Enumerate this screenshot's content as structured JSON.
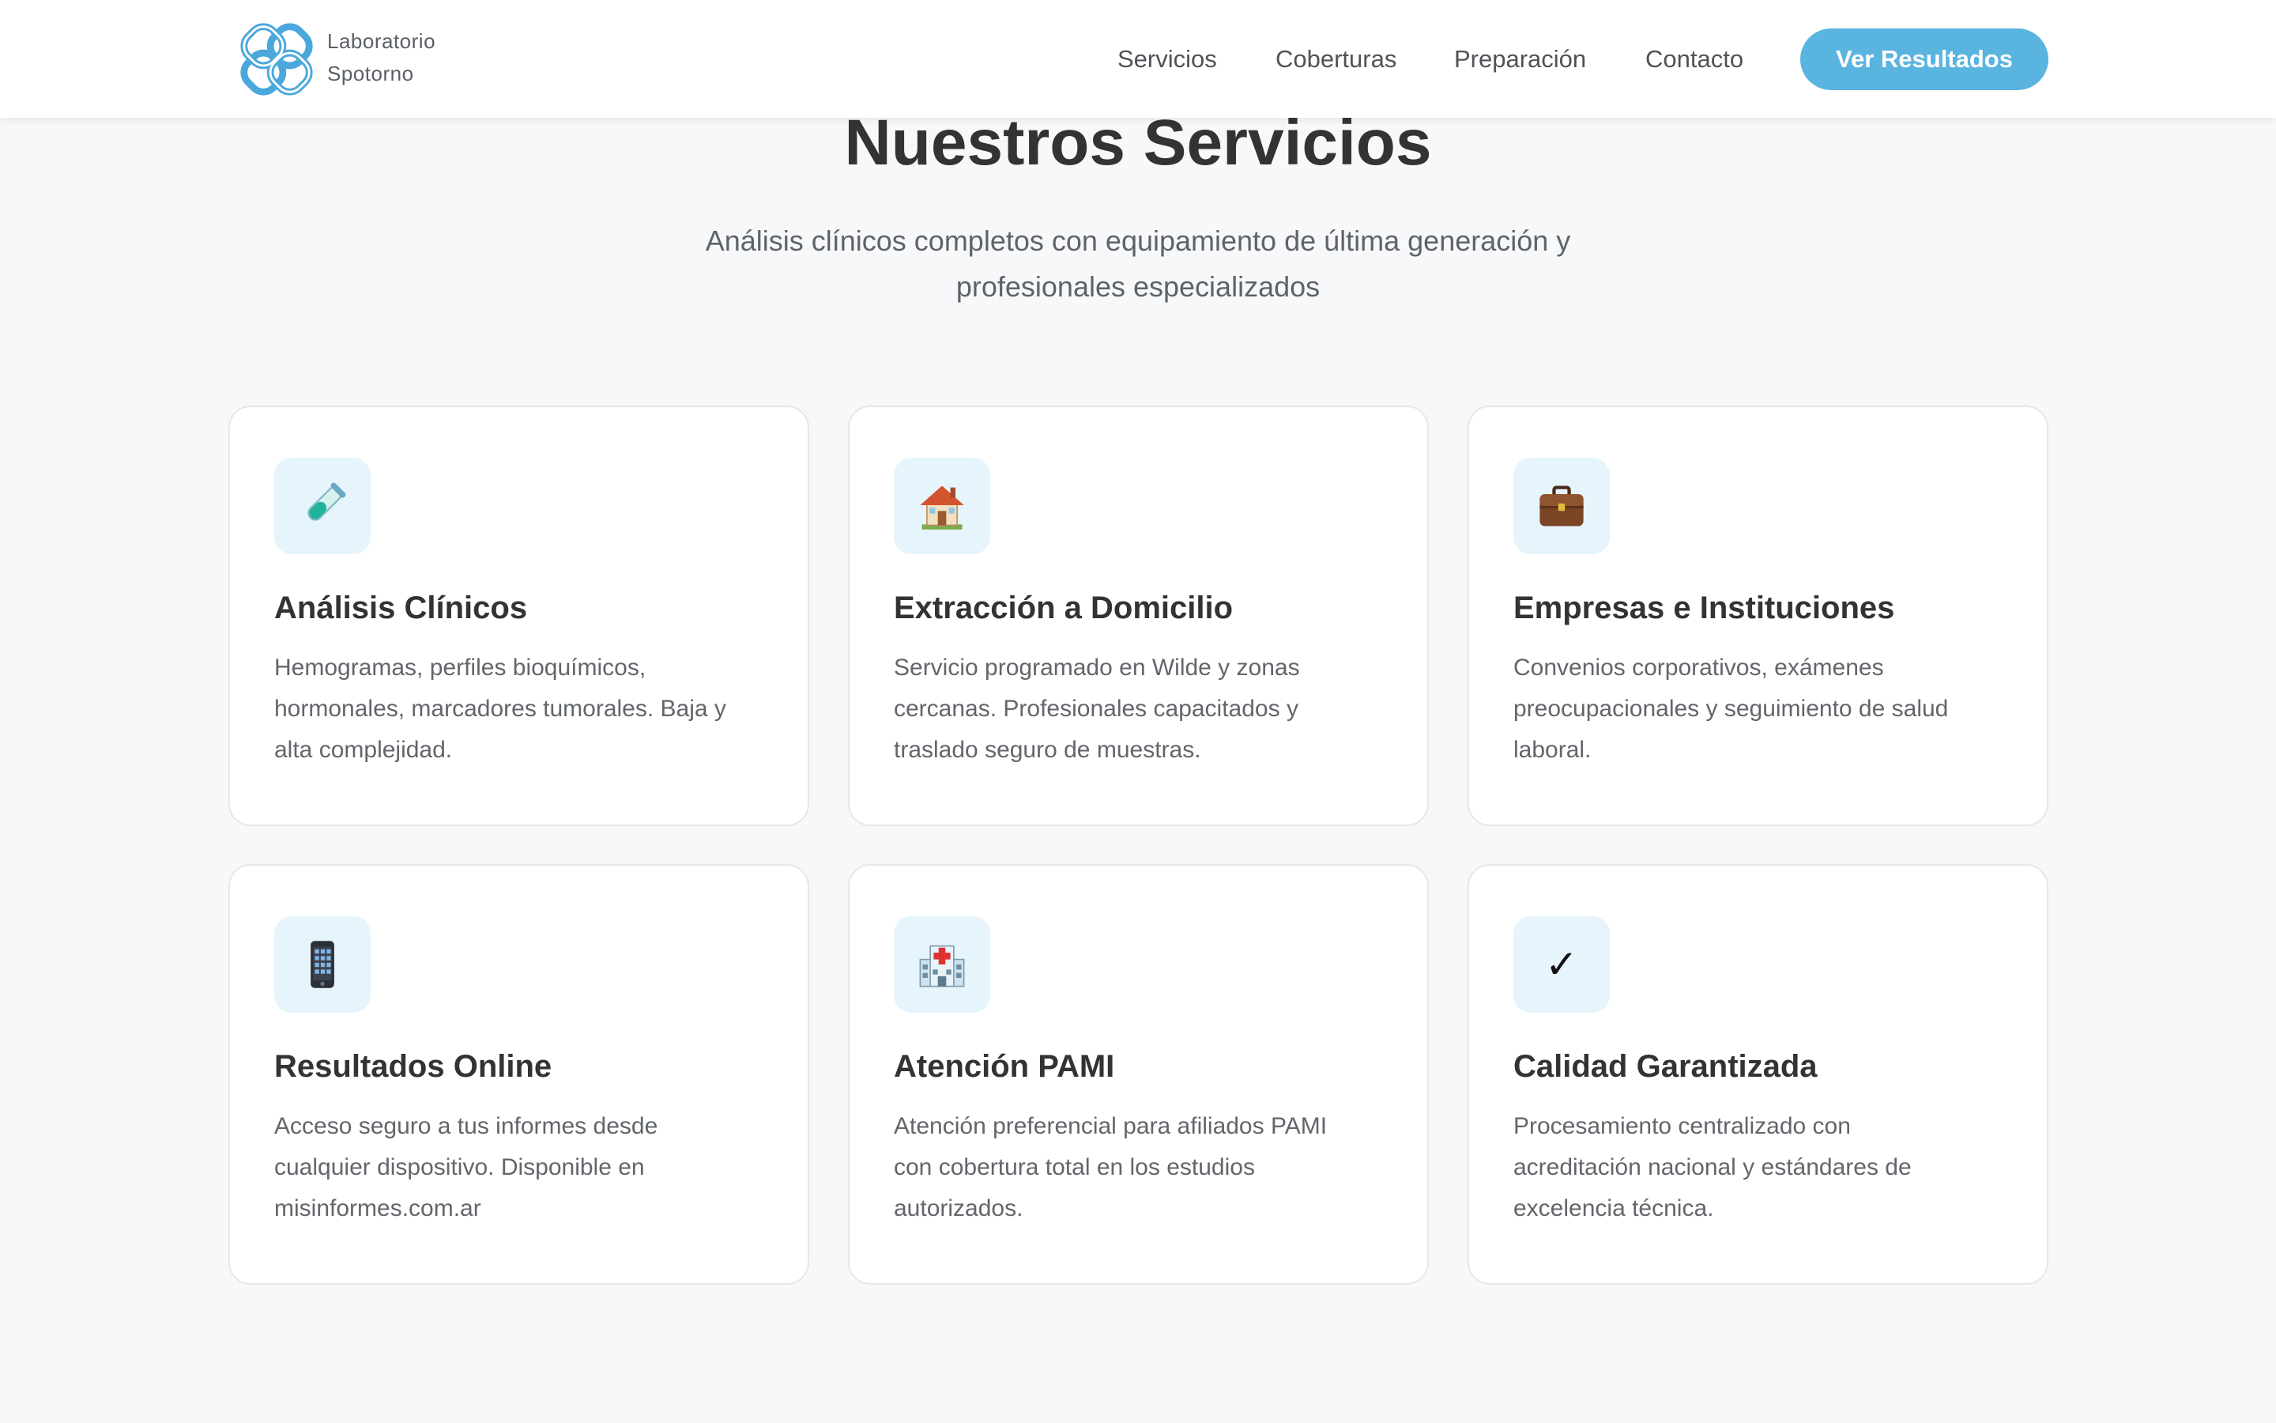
{
  "brand": {
    "name_line1": "Laboratorio",
    "name_line2": "Spotorno",
    "logo_icon": "interlocked-loops-logo-icon",
    "accent_color": "#5ab4e0"
  },
  "nav": {
    "items": [
      {
        "label": "Servicios"
      },
      {
        "label": "Coberturas"
      },
      {
        "label": "Preparación"
      },
      {
        "label": "Contacto"
      }
    ],
    "cta_label": "Ver Resultados"
  },
  "section": {
    "title": "Nuestros Servicios",
    "subtitle_line1": "Análisis clínicos completos con equipamiento de última generación y",
    "subtitle_line2": "profesionales especializados"
  },
  "services": [
    {
      "icon": "test-tube-icon",
      "title": "Análisis Clínicos",
      "lines": [
        "Hemogramas, perfiles bioquímicos,",
        "hormonales, marcadores tumorales. Baja y",
        "alta complejidad."
      ]
    },
    {
      "icon": "house-icon",
      "title": "Extracción a Domicilio",
      "lines": [
        "Servicio programado en Wilde y zonas",
        "cercanas. Profesionales capacitados y",
        "traslado seguro de muestras."
      ]
    },
    {
      "icon": "briefcase-icon",
      "title": "Empresas e Instituciones",
      "lines": [
        "Convenios corporativos, exámenes",
        "preocupacionales y seguimiento de salud",
        "laboral."
      ]
    },
    {
      "icon": "mobile-phone-icon",
      "title": "Resultados Online",
      "lines": [
        "Acceso seguro a tus informes desde",
        "cualquier dispositivo. Disponible en",
        "misinformes.com.ar"
      ]
    },
    {
      "icon": "hospital-icon",
      "title": "Atención PAMI",
      "lines": [
        "Atención preferencial para afiliados PAMI",
        "con cobertura total en los estudios",
        "autorizados."
      ]
    },
    {
      "icon": "checkmark-icon",
      "title": "Calidad Garantizada",
      "check_glyph": "✓",
      "lines": [
        "Procesamiento centralizado con",
        "acreditación nacional y estándares de",
        "excelencia técnica."
      ]
    }
  ]
}
